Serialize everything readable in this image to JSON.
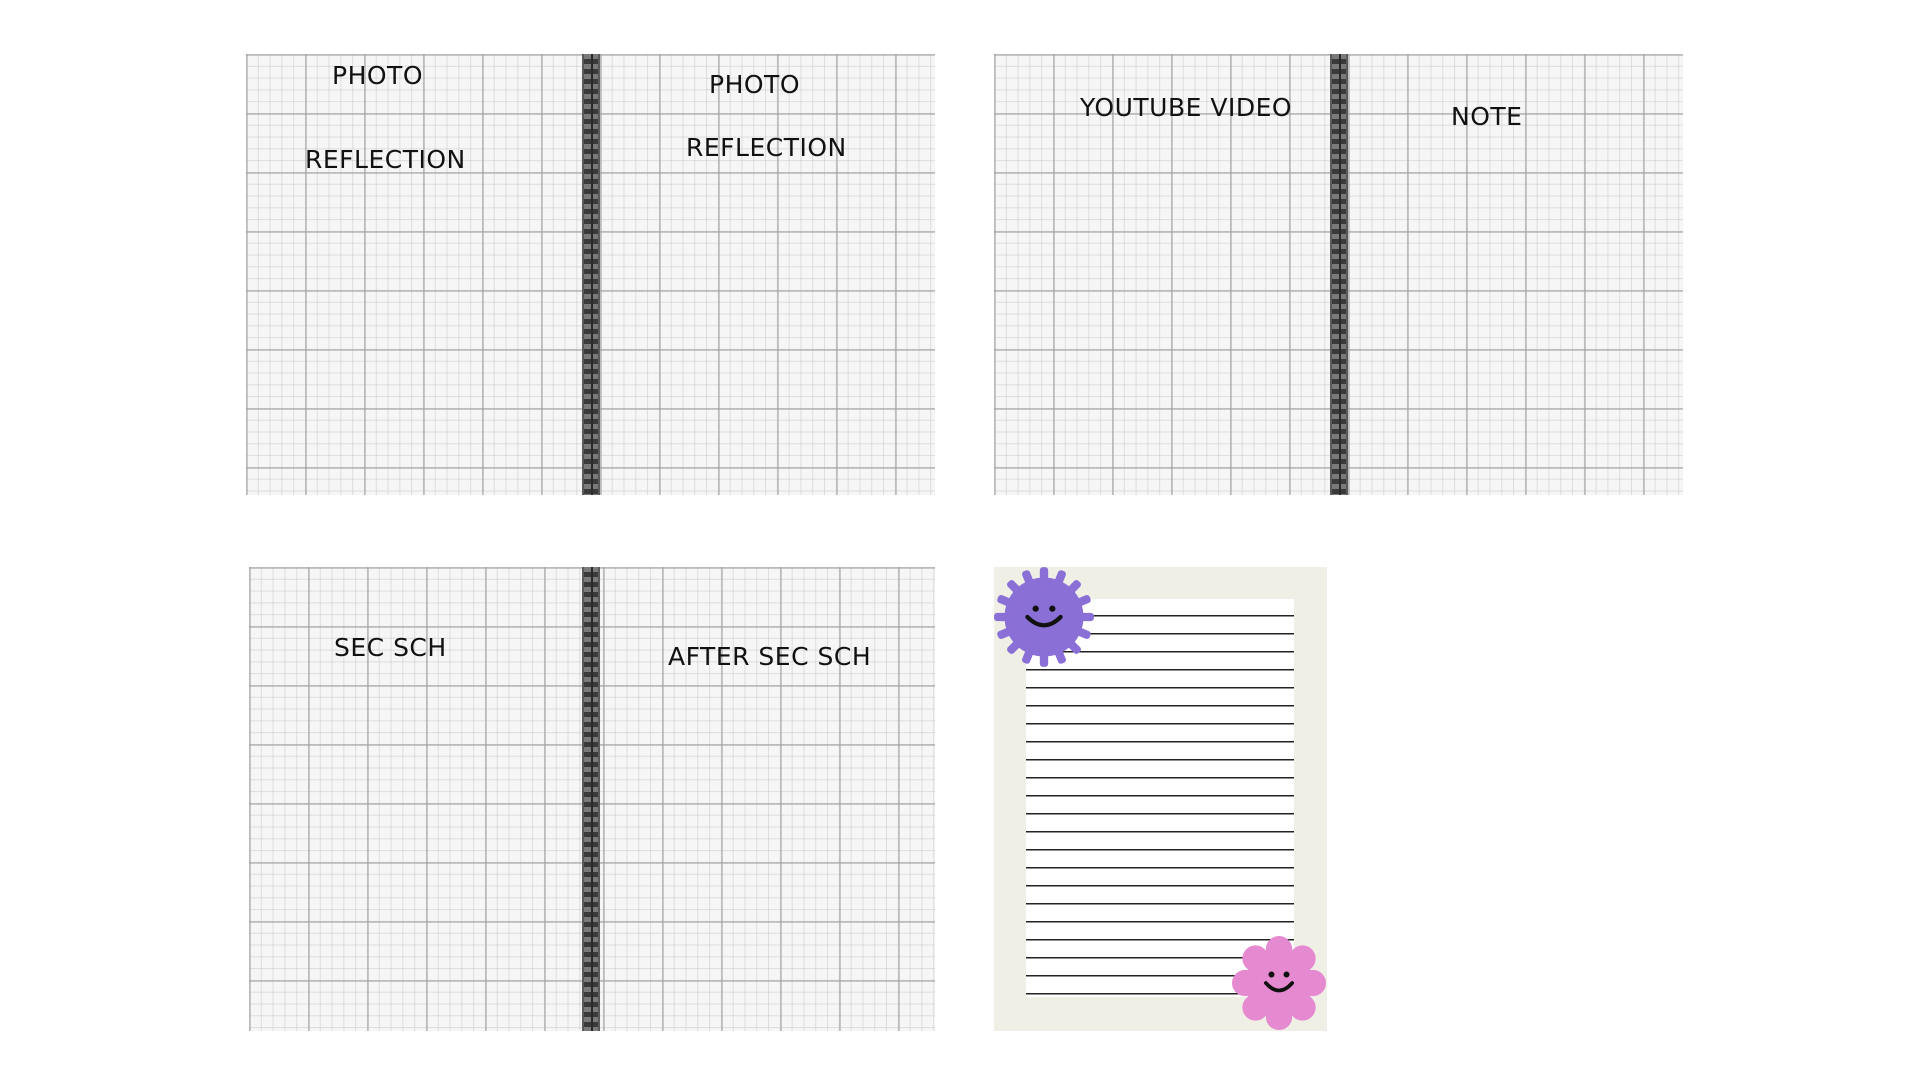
{
  "spreads": [
    {
      "left_labels": [
        "PHOTO",
        "REFLECTION"
      ],
      "right_labels": [
        "PHOTO",
        "REFLECTION"
      ]
    },
    {
      "left_labels": [
        "YOUTUBE VIDEO"
      ],
      "right_labels": [
        "NOTE"
      ]
    },
    {
      "left_labels": [
        "SEC SCH"
      ],
      "right_labels": [
        "AFTER SEC SCH"
      ]
    }
  ],
  "memo": {
    "stickers": [
      {
        "icon": "smiley-flower-icon",
        "color": "#8a6fd6"
      },
      {
        "icon": "smiley-flower-icon",
        "color": "#e58ad0"
      }
    ]
  },
  "colors": {
    "grid_background": "#f6f6f6",
    "spiral": "#4a4a4a",
    "memo_background": "#efefe6",
    "purple_sticker": "#8a6fd6",
    "pink_sticker": "#e58ad0"
  }
}
